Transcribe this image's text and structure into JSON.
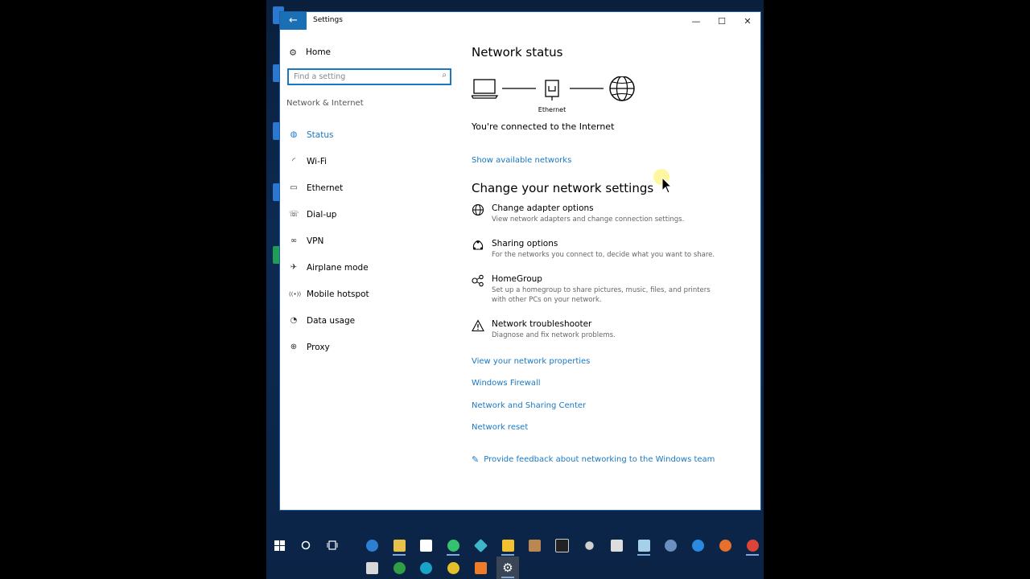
{
  "window": {
    "title": "Settings",
    "back_glyph": "←",
    "min_glyph": "—",
    "max_glyph": "☐",
    "close_glyph": "✕"
  },
  "sidebar": {
    "home_label": "Home",
    "search_placeholder": "Find a setting",
    "section_label": "Network & Internet",
    "items": [
      {
        "label": "Status",
        "icon": "status-globe-icon",
        "glyph": "◍",
        "active": true
      },
      {
        "label": "Wi-Fi",
        "icon": "wifi-icon",
        "glyph": "◜",
        "active": false
      },
      {
        "label": "Ethernet",
        "icon": "ethernet-icon",
        "glyph": "▭",
        "active": false
      },
      {
        "label": "Dial-up",
        "icon": "dialup-icon",
        "glyph": "☏",
        "active": false
      },
      {
        "label": "VPN",
        "icon": "vpn-icon",
        "glyph": "∞",
        "active": false
      },
      {
        "label": "Airplane mode",
        "icon": "airplane-icon",
        "glyph": "✈",
        "active": false
      },
      {
        "label": "Mobile hotspot",
        "icon": "hotspot-icon",
        "glyph": "((•))",
        "active": false
      },
      {
        "label": "Data usage",
        "icon": "data-usage-icon",
        "glyph": "◔",
        "active": false
      },
      {
        "label": "Proxy",
        "icon": "proxy-globe-icon",
        "glyph": "⊕",
        "active": false
      }
    ]
  },
  "content": {
    "network_status_heading": "Network status",
    "diagram_ethernet_label": "Ethernet",
    "connected_text": "You're connected to the Internet",
    "show_networks_link": "Show available networks",
    "change_heading": "Change your network settings",
    "settings": [
      {
        "title": "Change adapter options",
        "desc": "View network adapters and change connection settings.",
        "icon": "adapter-globe-icon"
      },
      {
        "title": "Sharing options",
        "desc": "For the networks you connect to, decide what you want to share.",
        "icon": "sharing-icon"
      },
      {
        "title": "HomeGroup",
        "desc": "Set up a homegroup to share pictures, music, files, and printers with other PCs on your network.",
        "icon": "homegroup-icon"
      },
      {
        "title": "Network troubleshooter",
        "desc": "Diagnose and fix network problems.",
        "icon": "warning-icon"
      }
    ],
    "links": [
      "View your network properties",
      "Windows Firewall",
      "Network and Sharing Center",
      "Network reset"
    ],
    "feedback_link": "Provide feedback about networking to the Windows team"
  },
  "colors": {
    "accent": "#1a78c2",
    "title_accent": "#1a6fb5"
  }
}
